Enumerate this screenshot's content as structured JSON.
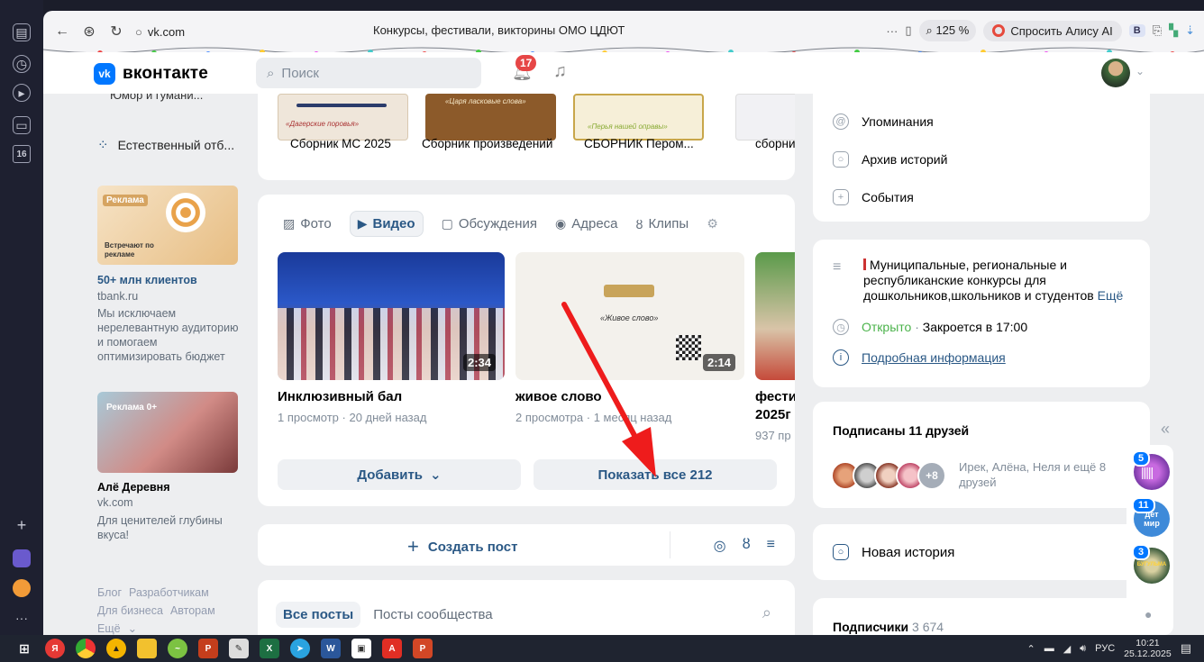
{
  "browser": {
    "url": "vk.com",
    "page_title": "Конкурсы, фестивали, викторины ОМО ЦДЮТ",
    "zoom": "125 %",
    "alice_label": "Спросить Алису AI",
    "ext_label": "B",
    "sidebar_badge": "16"
  },
  "header": {
    "logo_letter": "vk",
    "logo_text": "вконтакте",
    "search_placeholder": "Поиск",
    "notifications_count": "17"
  },
  "left": {
    "cut_label": "Юмор и гумани...",
    "menu_item": "Естественный отб...",
    "ad1": {
      "badge": "Реклама",
      "img_text": "Встречают по рекламе",
      "title": "50+ млн клиентов",
      "url": "tbank.ru",
      "text": "Мы исключаем нерелевантную аудиторию и помогаем оптимизировать бюджет"
    },
    "ad2": {
      "badge": "Реклама 0+",
      "title": "Алё Деревня",
      "url": "vk.com",
      "text": "Для ценителей глубины вкуса!"
    },
    "footer": [
      "Блог",
      "Разработчикам",
      "Для бизнеса",
      "Авторам",
      "Ещё"
    ]
  },
  "albums": [
    {
      "label": "Сборник МС 2025",
      "thumb_text": "«Дагерские поровья»"
    },
    {
      "label": "Сборник произведений",
      "thumb_text": "«Царя ласковые слова»"
    },
    {
      "label": "СБОРНИК Пером...",
      "thumb_text": "«Перья нашей оправы»"
    },
    {
      "label": "сборни",
      "thumb_text": ""
    }
  ],
  "media_tabs": [
    {
      "label": "Фото",
      "icon": "photo-icon"
    },
    {
      "label": "Видео",
      "icon": "video-icon"
    },
    {
      "label": "Обсуждения",
      "icon": "discussion-icon"
    },
    {
      "label": "Адреса",
      "icon": "location-icon"
    },
    {
      "label": "Клипы",
      "icon": "clips-icon"
    }
  ],
  "videos": [
    {
      "title": "Инклюзивный бал",
      "meta": "1 просмотр · 20 дней назад",
      "duration": "2:34"
    },
    {
      "title": "живое слово",
      "meta": "2 просмотра · 1 месяц назад",
      "duration": "2:14",
      "thumb_text": "«Живое слово»"
    },
    {
      "title": "фести",
      "title2": "2025г",
      "meta": "937 пр",
      "duration": ""
    }
  ],
  "buttons": {
    "add": "Добавить",
    "show_all": "Показать все 212",
    "create_post": "Создать пост"
  },
  "posts_tabs": {
    "all": "Все посты",
    "community": "Посты сообщества"
  },
  "right": {
    "menu": [
      "Упоминания",
      "Архив историй",
      "События"
    ],
    "info_title": "Муниципальные, региональные и республиканские конкурсы для дошкольников,школьников и студентов",
    "info_more": "Ещё",
    "open_status": "Открыто",
    "closes": "Закроется в 17:00",
    "details_link": "Подробная информация",
    "friends_title": "Подписаны 11 друзей",
    "friends_more": "+8",
    "friends_names": "Ирек, Алёна, Неля и ещё 8 друзей",
    "new_story": "Новая история",
    "subscribers_label": "Подписчики",
    "subscribers_count": "3 674"
  },
  "groups_float": [
    {
      "badge": "5",
      "text": ""
    },
    {
      "badge": "11",
      "text": "дет мир"
    },
    {
      "badge": "3",
      "text": "БУГУЛЬМА"
    }
  ],
  "taskbar": {
    "lang": "РУС",
    "time": "10:21",
    "date": "25.12.2025"
  }
}
